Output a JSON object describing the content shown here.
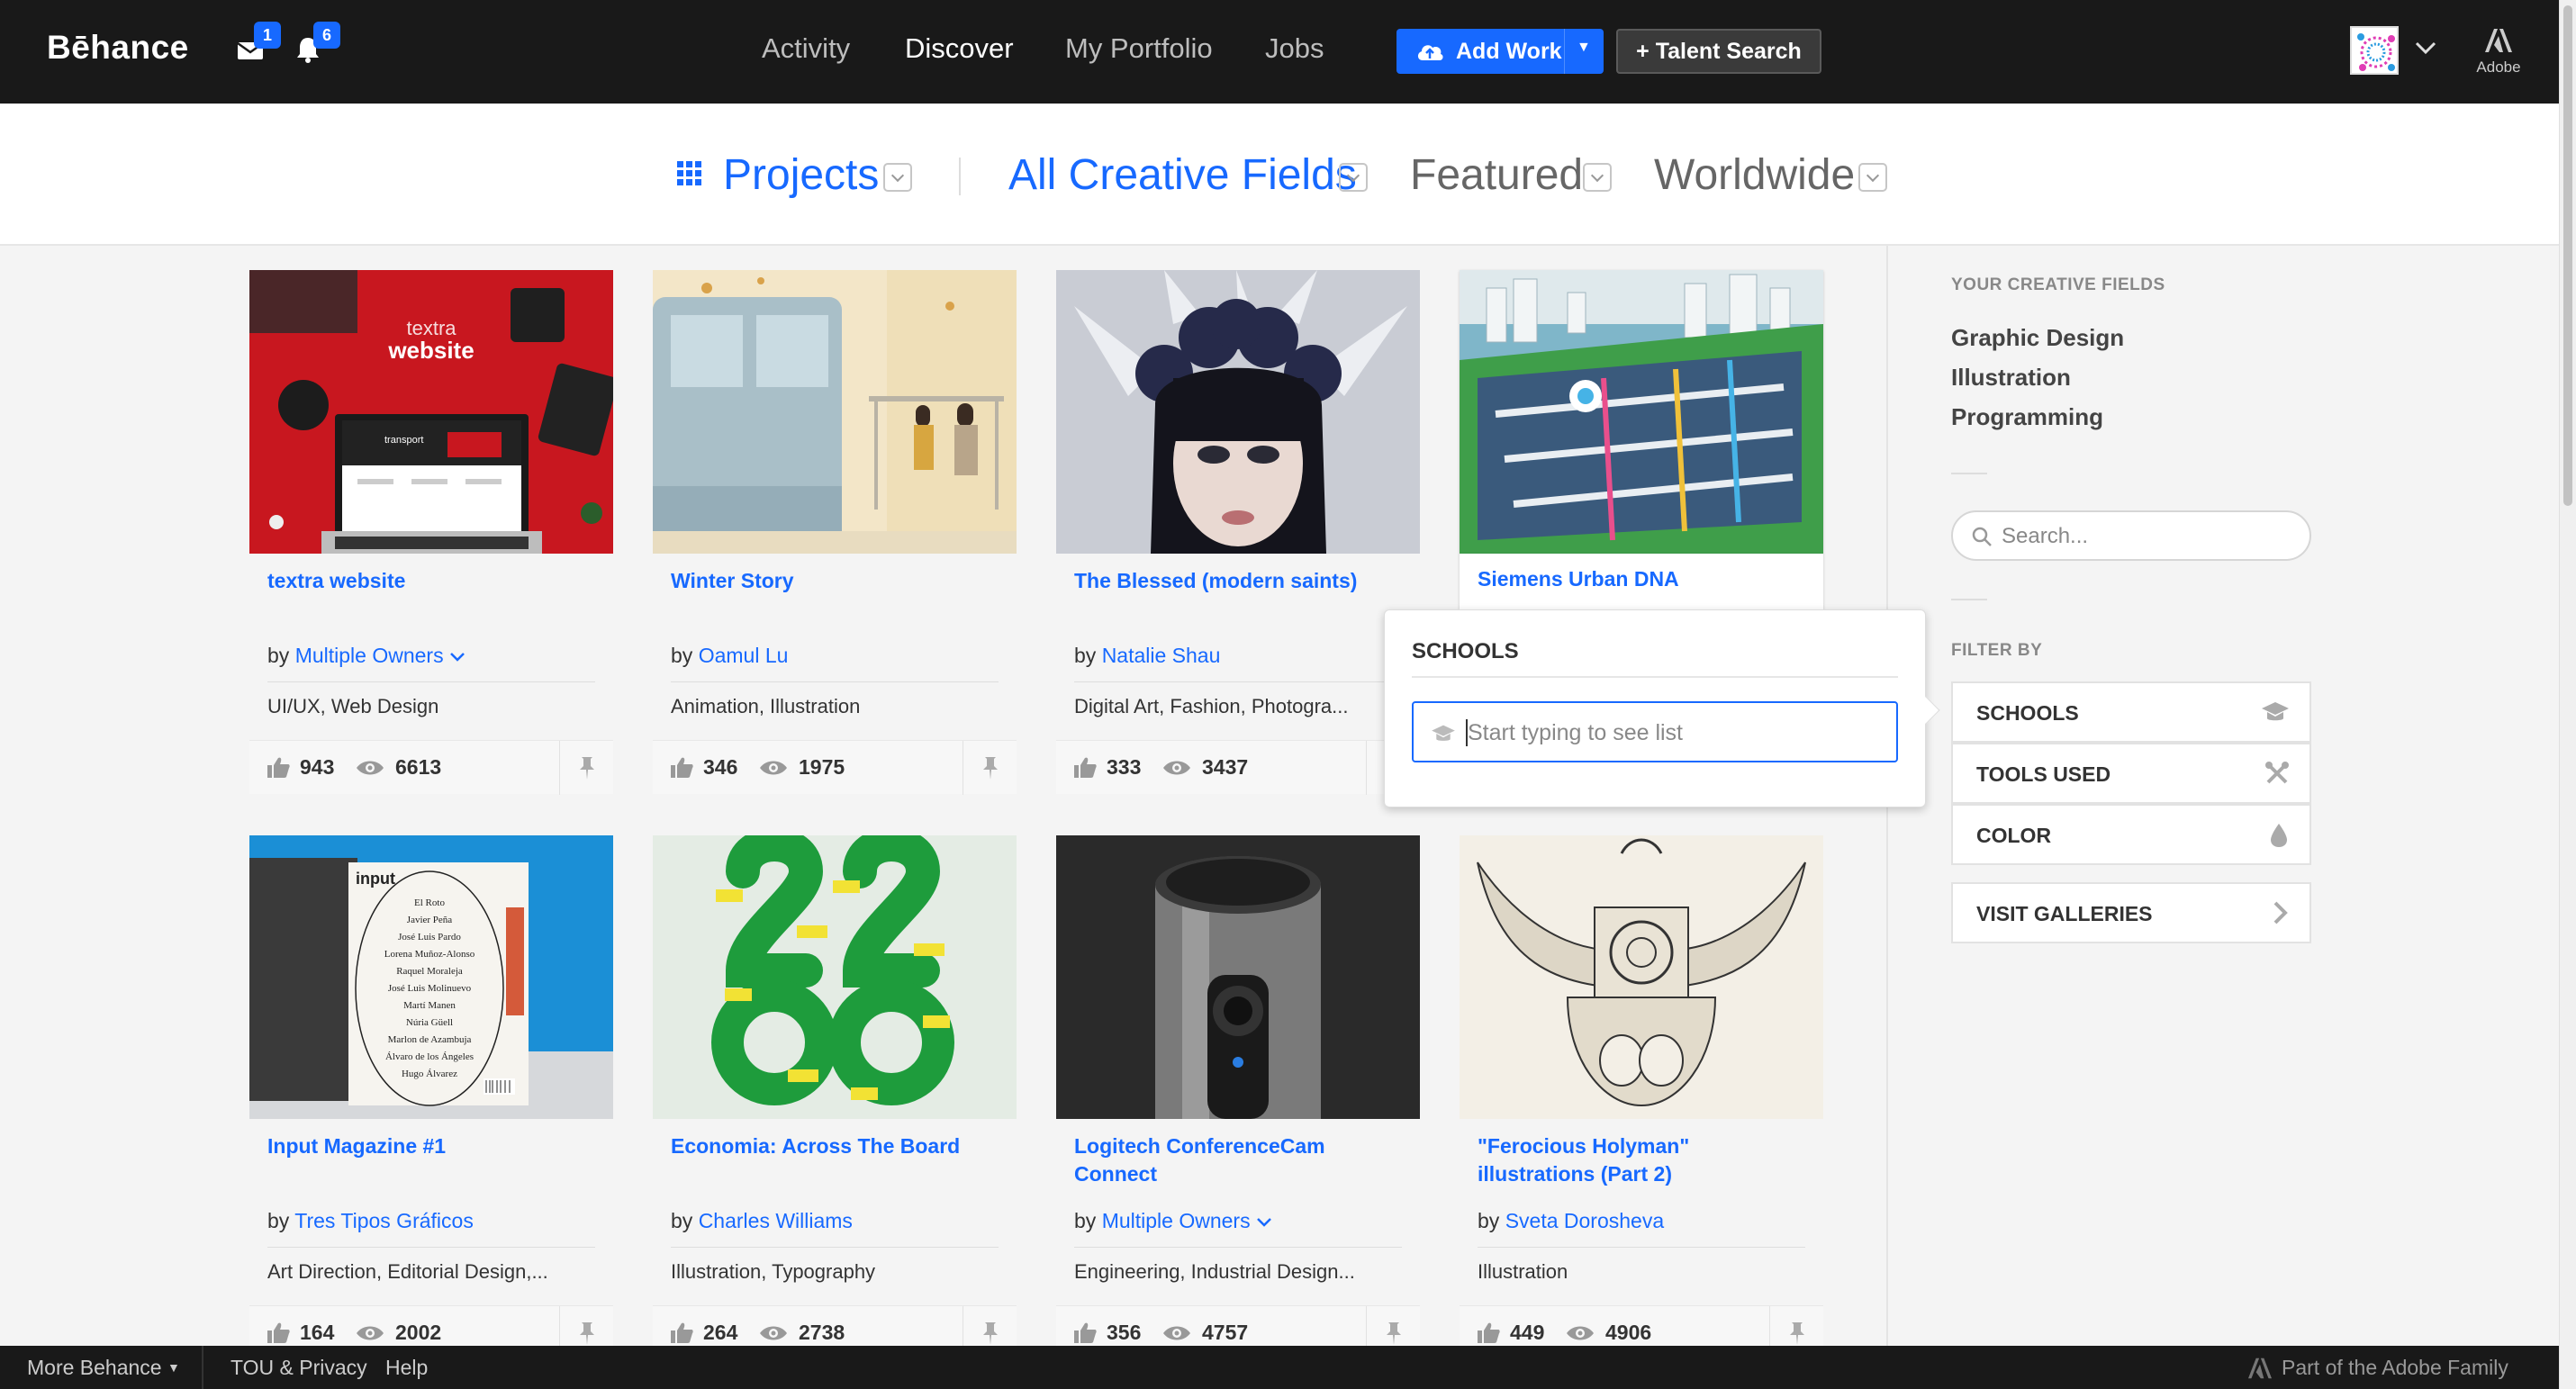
{
  "header": {
    "logo": "Bēhance",
    "messages_badge": "1",
    "notifications_badge": "6",
    "nav": [
      "Activity",
      "Discover",
      "My Portfolio",
      "Jobs"
    ],
    "active_nav": "Discover",
    "add_work": "Add Work",
    "talent_search": "+ Talent Search",
    "adobe": "Adobe"
  },
  "filters": {
    "projects": "Projects",
    "creative_fields": "All Creative Fields",
    "featured": "Featured",
    "worldwide": "Worldwide"
  },
  "projects": [
    {
      "title": "textra website",
      "by": "by",
      "owner": "Multiple Owners",
      "owner_dropdown": true,
      "fields": "UI/UX, Web Design",
      "likes": "943",
      "views": "6613"
    },
    {
      "title": "Winter Story",
      "by": "by",
      "owner": "Oamul Lu",
      "fields": "Animation, Illustration",
      "likes": "346",
      "views": "1975"
    },
    {
      "title": "The Blessed (modern saints)",
      "by": "by",
      "owner": "Natalie Shau",
      "fields": "Digital Art, Fashion, Photogra...",
      "likes": "333",
      "views": "3437"
    },
    {
      "title": "Siemens Urban DNA",
      "by": "by",
      "owner": "",
      "fields": "",
      "likes": "",
      "views": ""
    },
    {
      "title": "Input Magazine #1",
      "by": "by",
      "owner": "Tres Tipos Gráficos",
      "fields": "Art Direction, Editorial Design,...",
      "likes": "164",
      "views": "2002"
    },
    {
      "title": "Economia: Across The Board",
      "by": "by",
      "owner": "Charles Williams",
      "fields": "Illustration, Typography",
      "likes": "264",
      "views": "2738"
    },
    {
      "title": "Logitech ConferenceCam Connect",
      "by": "by",
      "owner": "Multiple Owners",
      "owner_dropdown": true,
      "fields": "Engineering, Industrial Design...",
      "likes": "356",
      "views": "4757"
    },
    {
      "title": "\"Ferocious Holyman\" illustrations (Part 2)",
      "by": "by",
      "owner": "Sveta Dorosheva",
      "fields": "Illustration",
      "likes": "449",
      "views": "4906"
    }
  ],
  "thumb_text": {
    "textra_small": "textra",
    "textra_big": "website",
    "textra_screen": "transport",
    "input_logo": "input",
    "input_names": [
      "El Roto",
      "Javier Peña",
      "José Luis Pardo",
      "Lorena Muñoz-Alonso",
      "Raquel Moraleja",
      "José Luis Molinuevo",
      "Martí Manen",
      "Núria Güell",
      "Marlon de Azambuja",
      "Álvaro de los Ángeles",
      "Hugo Álvarez"
    ]
  },
  "sidebar": {
    "creative_fields_heading": "YOUR CREATIVE FIELDS",
    "creative_fields": [
      "Graphic Design",
      "Illustration",
      "Programming"
    ],
    "search_placeholder": "Search...",
    "filter_by_heading": "FILTER BY",
    "filters": [
      {
        "label": "SCHOOLS",
        "icon": "graduation-cap-icon"
      },
      {
        "label": "TOOLS USED",
        "icon": "tools-icon"
      },
      {
        "label": "COLOR",
        "icon": "droplet-icon"
      }
    ],
    "visit_galleries": "VISIT GALLERIES"
  },
  "popover": {
    "title": "SCHOOLS",
    "input_placeholder": "Start typing to see list"
  },
  "footer": {
    "more_behance": "More Behance",
    "tou": "TOU & Privacy",
    "help": "Help",
    "adobe_family": "Part of the Adobe Family"
  },
  "colors": {
    "accent": "#1769ff",
    "topbar": "#191919",
    "tile_red": "#c41e24"
  }
}
